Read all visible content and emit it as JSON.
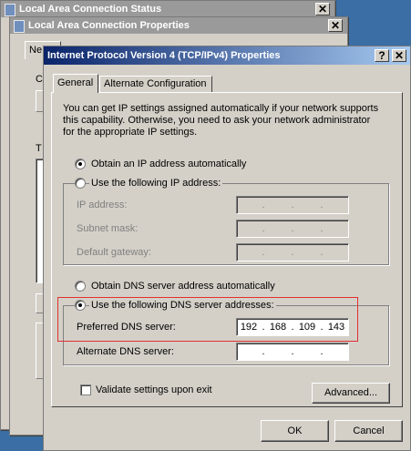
{
  "window_status": {
    "title": "Local Area Connection Status",
    "close": "✕"
  },
  "window_props": {
    "title": "Local Area Connection Properties",
    "close": "✕",
    "tab_fragment": "Ne",
    "frag_c": "C",
    "frag_t": "T"
  },
  "dialog": {
    "title": "Internet Protocol Version 4 (TCP/IPv4) Properties",
    "help_button": "?",
    "close_button": "✕",
    "tabs": [
      "General",
      "Alternate Configuration"
    ],
    "description": [
      "You can get IP settings assigned automatically if your network supports",
      "this capability. Otherwise, you need to ask your network administrator",
      "for the appropriate IP settings."
    ],
    "ip": {
      "auto_label": "Obtain an IP address automatically",
      "manual_label": "Use the following IP address:",
      "selected": "auto",
      "fields": [
        {
          "label": "IP address:",
          "octets": [
            "",
            "",
            "",
            ""
          ]
        },
        {
          "label": "Subnet mask:",
          "octets": [
            "",
            "",
            "",
            ""
          ]
        },
        {
          "label": "Default gateway:",
          "octets": [
            "",
            "",
            "",
            ""
          ]
        }
      ]
    },
    "dns": {
      "auto_label": "Obtain DNS server address automatically",
      "manual_label": "Use the following DNS server addresses:",
      "selected": "manual",
      "preferred": {
        "label": "Preferred DNS server:",
        "octets": [
          "192",
          "168",
          "109",
          "143"
        ]
      },
      "alternate": {
        "label": "Alternate DNS server:",
        "octets": [
          "",
          "",
          "",
          ""
        ]
      }
    },
    "validate_label": "Validate settings upon exit",
    "validate_checked": false,
    "advanced_button": "Advanced...",
    "ok_button": "OK",
    "cancel_button": "Cancel"
  }
}
